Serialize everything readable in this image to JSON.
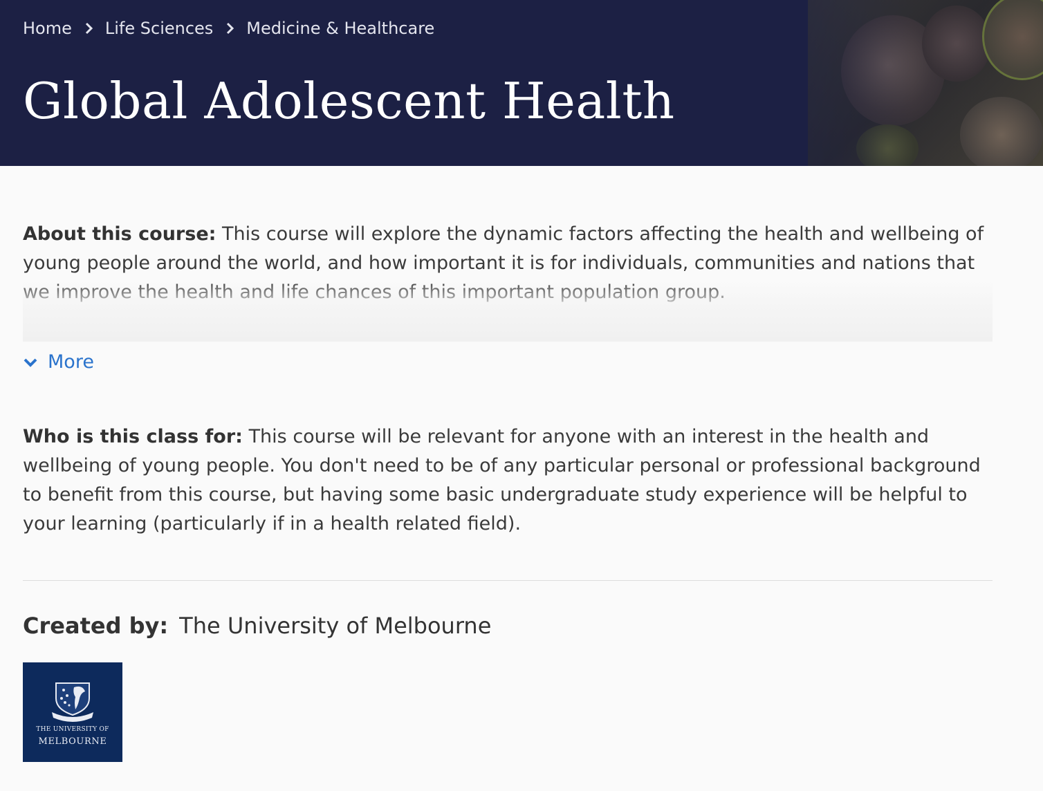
{
  "breadcrumb": {
    "items": [
      "Home",
      "Life Sciences",
      "Medicine & Healthcare"
    ]
  },
  "course": {
    "title": "Global Adolescent Health"
  },
  "about": {
    "label": "About this course:",
    "text": "This course will explore the dynamic factors affecting the health and wellbeing of young people around the world, and how important it is for individuals, communities and nations that we improve the health and life chances of this important population group.",
    "more_label": "More"
  },
  "audience": {
    "label": "Who is this class for:",
    "text": "This course will be relevant for anyone with an interest in the health and wellbeing of young people. You don't need to be of any particular personal or professional background to benefit from this course, but having some basic undergraduate study experience will be helpful to your learning (particularly if in a health related field)."
  },
  "creator": {
    "label": "Created by:",
    "name": "The University of Melbourne",
    "logo_line1": "THE UNIVERSITY OF",
    "logo_line2": "MELBOURNE"
  },
  "colors": {
    "hero_background": "#1c2044",
    "link": "#2a73cc",
    "logo_background": "#0d2a5c"
  },
  "icons": {
    "breadcrumb_separator": "chevron-right-icon",
    "more_toggle": "chevron-down-icon"
  }
}
